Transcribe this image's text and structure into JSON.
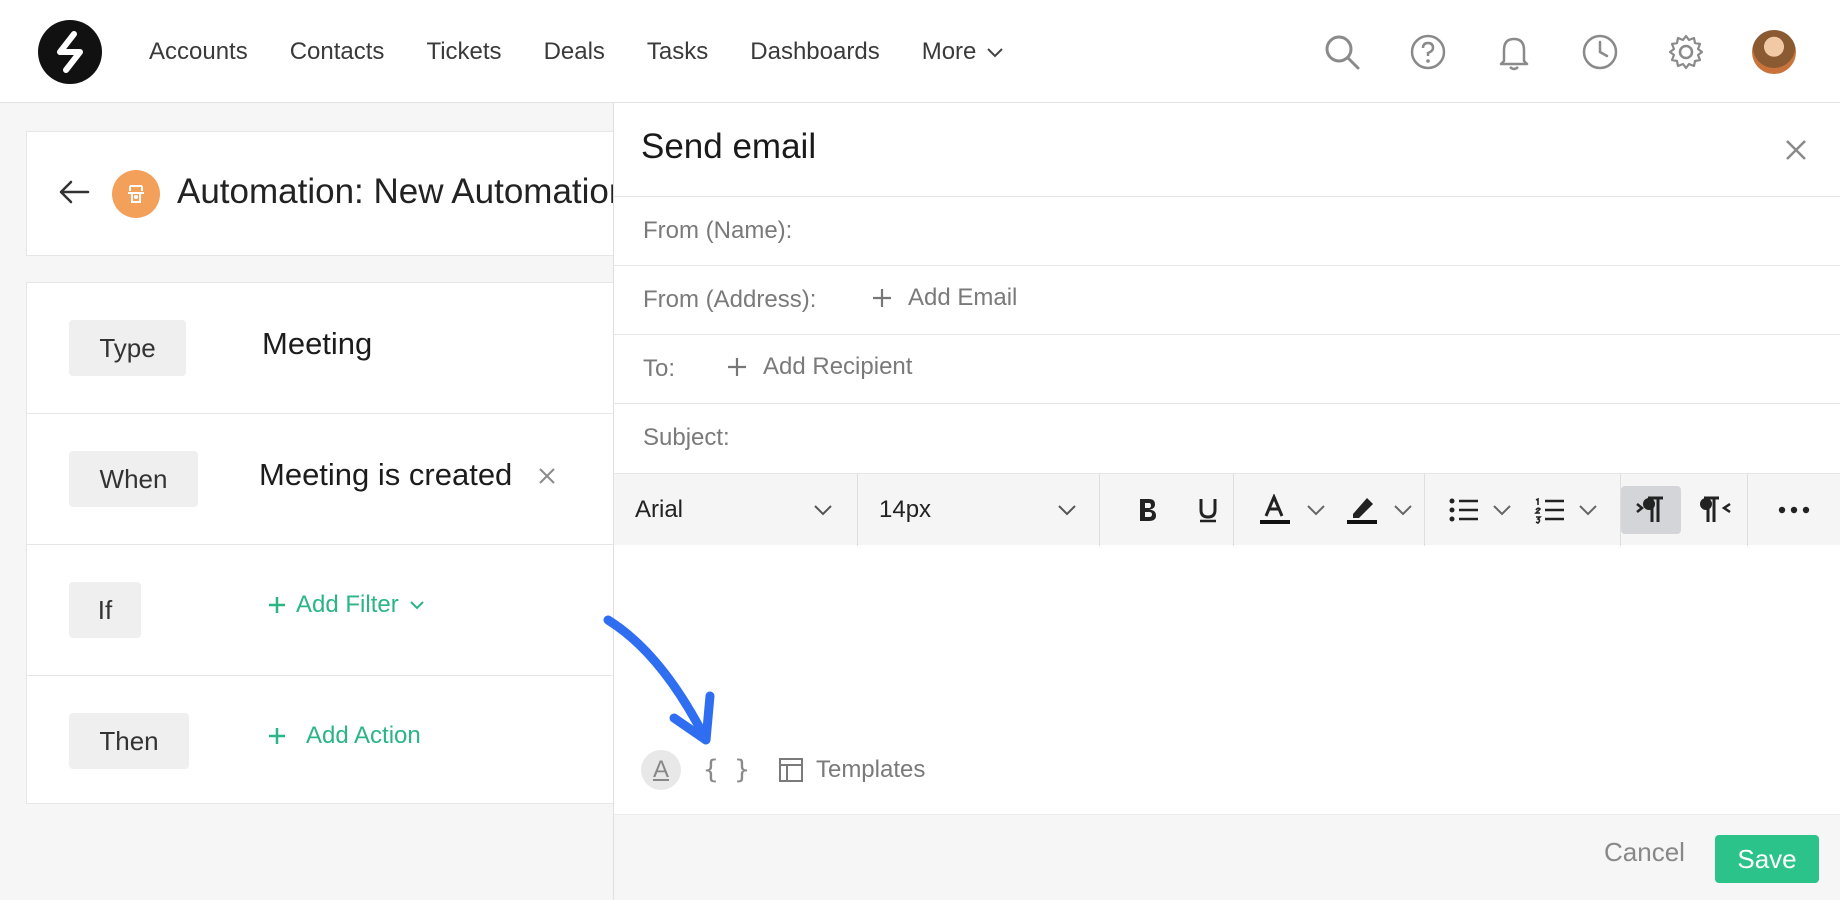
{
  "topnav": {
    "items": [
      {
        "label": "Accounts"
      },
      {
        "label": "Contacts"
      },
      {
        "label": "Tickets"
      },
      {
        "label": "Deals"
      },
      {
        "label": "Tasks"
      },
      {
        "label": "Dashboards"
      },
      {
        "label": "More"
      }
    ],
    "icons": [
      "search-icon",
      "help-icon",
      "bell-icon",
      "clock-icon",
      "gear-icon"
    ]
  },
  "automation": {
    "title": "Automation: New Automation",
    "rules": [
      {
        "label": "Type",
        "value": "Meeting"
      },
      {
        "label": "When",
        "value": "Meeting is created"
      },
      {
        "label": "If",
        "action": "Add Filter"
      },
      {
        "label": "Then",
        "action": "Add Action"
      }
    ]
  },
  "email_panel": {
    "title": "Send email",
    "fields": {
      "from_name": "From (Name):",
      "from_address": "From (Address):",
      "add_email": "Add Email",
      "to": "To:",
      "add_recipient": "Add Recipient",
      "subject": "Subject:"
    },
    "toolbar": {
      "font_family": "Arial",
      "font_size": "14px"
    },
    "bottom": {
      "format_letter": "A",
      "braces": "{ }",
      "templates": "Templates"
    },
    "footer": {
      "cancel": "Cancel",
      "save": "Save"
    }
  },
  "colors": {
    "accent_green": "#2cc38a",
    "link_green": "#2bb585",
    "automation_icon": "#f3a05a",
    "annotation_arrow": "#2f6ef0"
  }
}
